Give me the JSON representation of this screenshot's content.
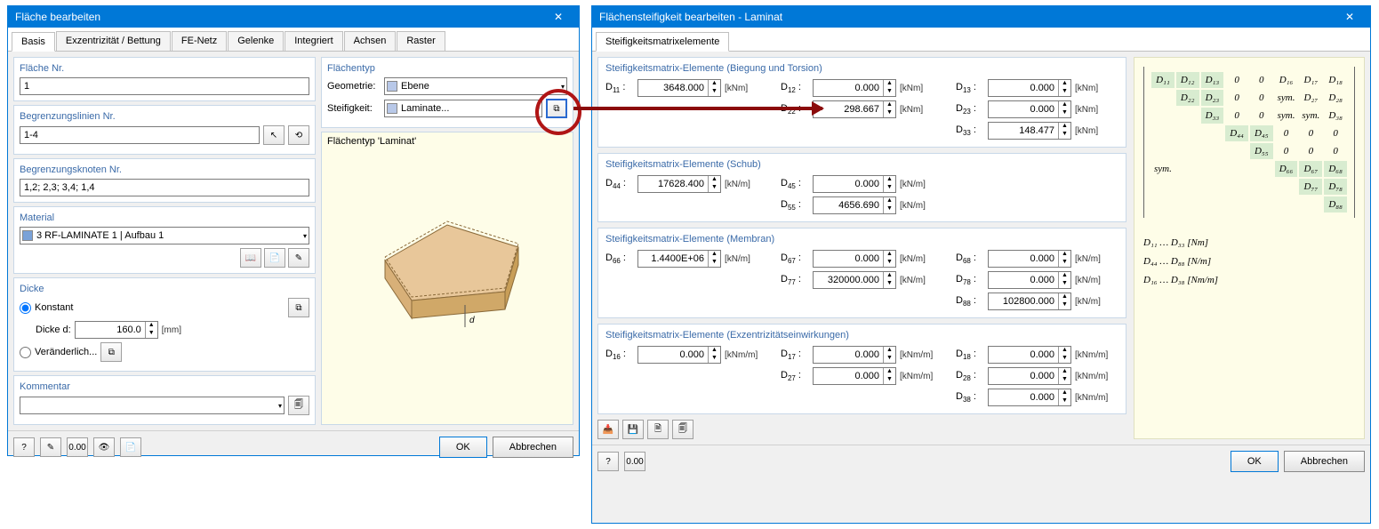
{
  "window_left": {
    "title": "Fläche bearbeiten",
    "tabs": [
      "Basis",
      "Exzentrizität / Bettung",
      "FE-Netz",
      "Gelenke",
      "Integriert",
      "Achsen",
      "Raster"
    ],
    "active_tab": 0,
    "surface_no": {
      "label": "Fläche Nr.",
      "value": "1"
    },
    "boundary_lines": {
      "label": "Begrenzungslinien Nr.",
      "value": "1-4"
    },
    "boundary_nodes": {
      "label": "Begrenzungsknoten Nr.",
      "value": "1,2; 2,3; 3,4; 1,4"
    },
    "material": {
      "label": "Material",
      "value": "3    RF-LAMINATE 1 | Aufbau 1"
    },
    "thickness": {
      "label": "Dicke",
      "constant": "Konstant",
      "thickness_label": "Dicke d:",
      "value": "160.0",
      "unit": "[mm]",
      "variable": "Veränderlich..."
    },
    "comment": {
      "label": "Kommentar",
      "value": ""
    },
    "surface_type": {
      "label": "Flächentyp",
      "geometry_label": "Geometrie:",
      "geometry_value": "Ebene",
      "stiffness_label": "Steifigkeit:",
      "stiffness_value": "Laminate..."
    },
    "preview_title": "Flächentyp 'Laminat'",
    "ok": "OK",
    "cancel": "Abbrechen"
  },
  "window_right": {
    "title": "Flächensteifigkeit bearbeiten - Laminat",
    "tab": "Steifigkeitsmatrixelemente",
    "groups": {
      "bending": {
        "title": "Steifigkeitsmatrix-Elemente (Biegung und Torsion)",
        "unit": "[kNm]",
        "D11": "3648.000",
        "D12": "0.000",
        "D13": "0.000",
        "D22": "298.667",
        "D23": "0.000",
        "D33": "148.477"
      },
      "shear": {
        "title": "Steifigkeitsmatrix-Elemente (Schub)",
        "unit": "[kN/m]",
        "D44": "17628.400",
        "D45": "0.000",
        "D55": "4656.690"
      },
      "membrane": {
        "title": "Steifigkeitsmatrix-Elemente (Membran)",
        "unit": "[kN/m]",
        "D66": "1.4400E+06",
        "D67": "0.000",
        "D68": "0.000",
        "D77": "320000.000",
        "D78": "0.000",
        "D88": "102800.000"
      },
      "ecc": {
        "title": "Steifigkeitsmatrix-Elemente (Exzentrizitätseinwirkungen)",
        "unit": "[kNm/m]",
        "D16": "0.000",
        "D17": "0.000",
        "D18": "0.000",
        "D27": "0.000",
        "D28": "0.000",
        "D38": "0.000"
      }
    },
    "legend": {
      "l1": "D₁₁ … D₃₃  [Nm]",
      "l2": "D₄₄ … D₈₈  [N/m]",
      "l3": "D₁₆ … D₃₈  [Nm/m]"
    },
    "ok": "OK",
    "cancel": "Abbrechen"
  }
}
